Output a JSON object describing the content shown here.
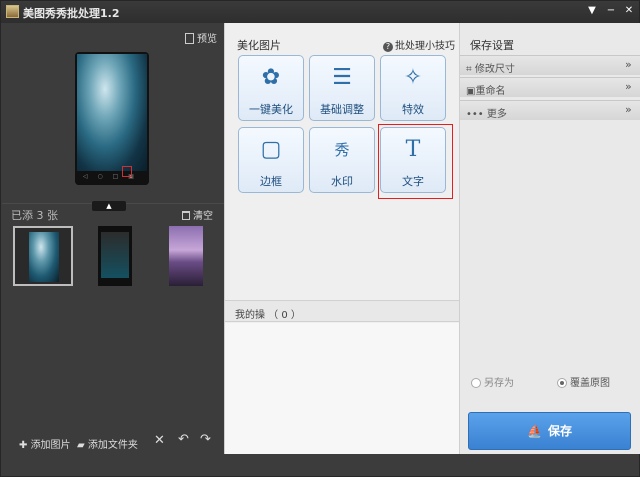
{
  "window": {
    "title": "美图秀秀批处理1.2",
    "menu_icon": "menu-icon",
    "min_glyph": "−",
    "close_glyph": "✕"
  },
  "left": {
    "preview_label": "预览",
    "added_text": "已添 3 张",
    "clear_label": "清空",
    "toggle_glyph": "▲",
    "thumbnails": [
      "thumb-1",
      "thumb-2",
      "thumb-3"
    ],
    "bottom": {
      "add_image": "添加图片",
      "add_folder": "添加文件夹",
      "delete_glyph": "✕",
      "rotate_left_glyph": "↶",
      "rotate_right_glyph": "↷"
    }
  },
  "middle": {
    "title": "美化图片",
    "tips": "批处理小技巧",
    "tools": [
      {
        "label": "一键美化",
        "icon": "tulip-icon",
        "glyph": "✿"
      },
      {
        "label": "基础调整",
        "icon": "sliders-icon",
        "glyph": "☰"
      },
      {
        "label": "特效",
        "icon": "magic-wand-icon",
        "glyph": "✧"
      },
      {
        "label": "边框",
        "icon": "frame-icon",
        "glyph": "▢"
      },
      {
        "label": "水印",
        "icon": "watermark-icon",
        "glyph": "秀"
      },
      {
        "label": "文字",
        "icon": "text-icon",
        "glyph": "T"
      }
    ],
    "ops_label": "我的操 （ 0 ）"
  },
  "right": {
    "title": "保存设置",
    "sections": [
      {
        "label": "修改尺寸",
        "icon": "crop-icon",
        "glyph": "⌗"
      },
      {
        "label": "重命名",
        "icon": "rename-icon",
        "glyph": "▣"
      },
      {
        "label": "更多",
        "icon": "more-icon",
        "glyph": "•••"
      }
    ],
    "chev": "»",
    "radio_save_as": "另存为",
    "radio_overwrite": "覆盖原图",
    "save_label": "保存"
  },
  "colors": {
    "accent": "#3a82d2",
    "selection": "#e02020"
  }
}
